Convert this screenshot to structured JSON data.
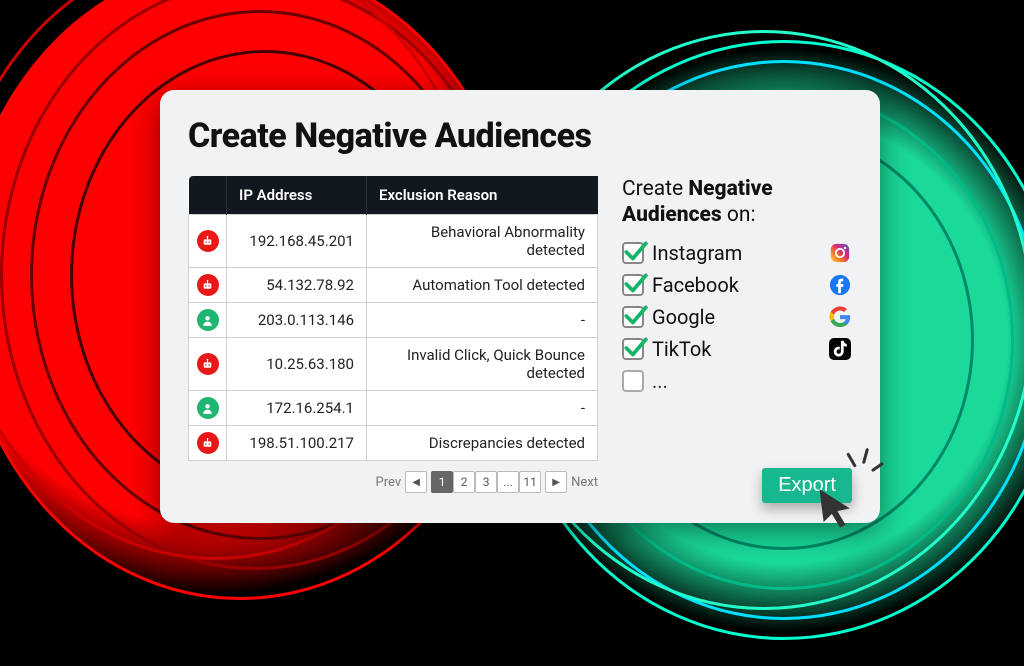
{
  "title": "Create Negative Audiences",
  "table": {
    "headers": {
      "icon": "",
      "ip": "IP Address",
      "reason": "Exclusion Reason"
    },
    "rows": [
      {
        "type": "bot",
        "ip": "192.168.45.201",
        "reason": "Behavioral Abnormality detected"
      },
      {
        "type": "bot",
        "ip": "54.132.78.92",
        "reason": "Automation Tool detected"
      },
      {
        "type": "user",
        "ip": "203.0.113.146",
        "reason": "-"
      },
      {
        "type": "bot",
        "ip": "10.25.63.180",
        "reason": "Invalid Click, Quick Bounce detected"
      },
      {
        "type": "user",
        "ip": "172.16.254.1",
        "reason": "-"
      },
      {
        "type": "bot",
        "ip": "198.51.100.217",
        "reason": "Discrepancies detected"
      }
    ]
  },
  "pagination": {
    "prev": "Prev",
    "next": "Next",
    "pages": [
      "1",
      "2",
      "3",
      "...",
      "11"
    ],
    "active": "1"
  },
  "side": {
    "line1": "Create ",
    "line2_bold": "Negative Audiences",
    "line3": " on:",
    "platforms": [
      {
        "name": "Instagram",
        "checked": true,
        "logo": "instagram"
      },
      {
        "name": "Facebook",
        "checked": true,
        "logo": "facebook"
      },
      {
        "name": "Google",
        "checked": true,
        "logo": "google"
      },
      {
        "name": "TikTok",
        "checked": true,
        "logo": "tiktok"
      },
      {
        "name": "...",
        "checked": false,
        "logo": ""
      }
    ]
  },
  "export_label": "Export"
}
